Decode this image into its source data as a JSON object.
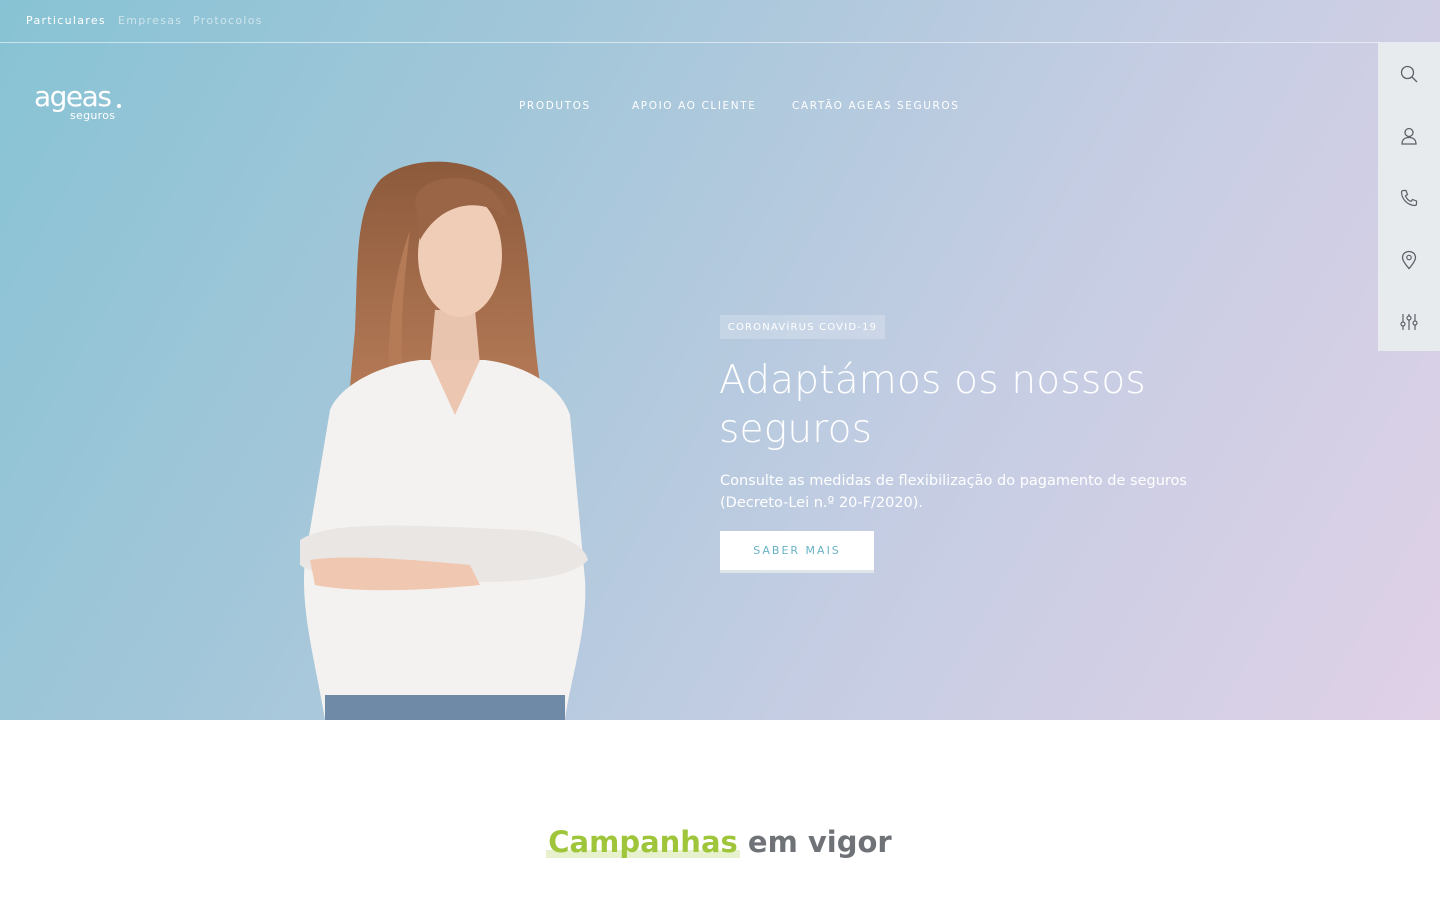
{
  "topbar": {
    "segments": [
      "Particulares",
      "Empresas",
      "Protocolos"
    ],
    "active": "Particulares"
  },
  "logo": {
    "main": "ageas",
    "sub": "seguros"
  },
  "nav": {
    "items": [
      "PRODUTOS",
      "APOIO AO CLIENTE",
      "CARTÃO AGEAS SEGUROS"
    ]
  },
  "sidebar": {
    "icons": [
      "search-icon",
      "user-icon",
      "phone-icon",
      "location-pin-icon",
      "filter-sliders-icon"
    ]
  },
  "hero": {
    "badge": "CORONAVÍRUS COVID-19",
    "title": "Adaptámos os nossos seguros",
    "text": "Consulte as medidas de flexibilização do pagamento de seguros (Decreto-Lei n.º 20-F/2020).",
    "cta": "SABER MAIS"
  },
  "campaigns": {
    "highlight": "Campanhas",
    "rest": "em vigor"
  },
  "colors": {
    "hero_gradient_start": "#87c3d4",
    "hero_gradient_end": "#e0d1e7",
    "accent_green": "#9fc63b",
    "cta_text": "#69b3c6",
    "sidebar_bg": "#e8ebee"
  }
}
